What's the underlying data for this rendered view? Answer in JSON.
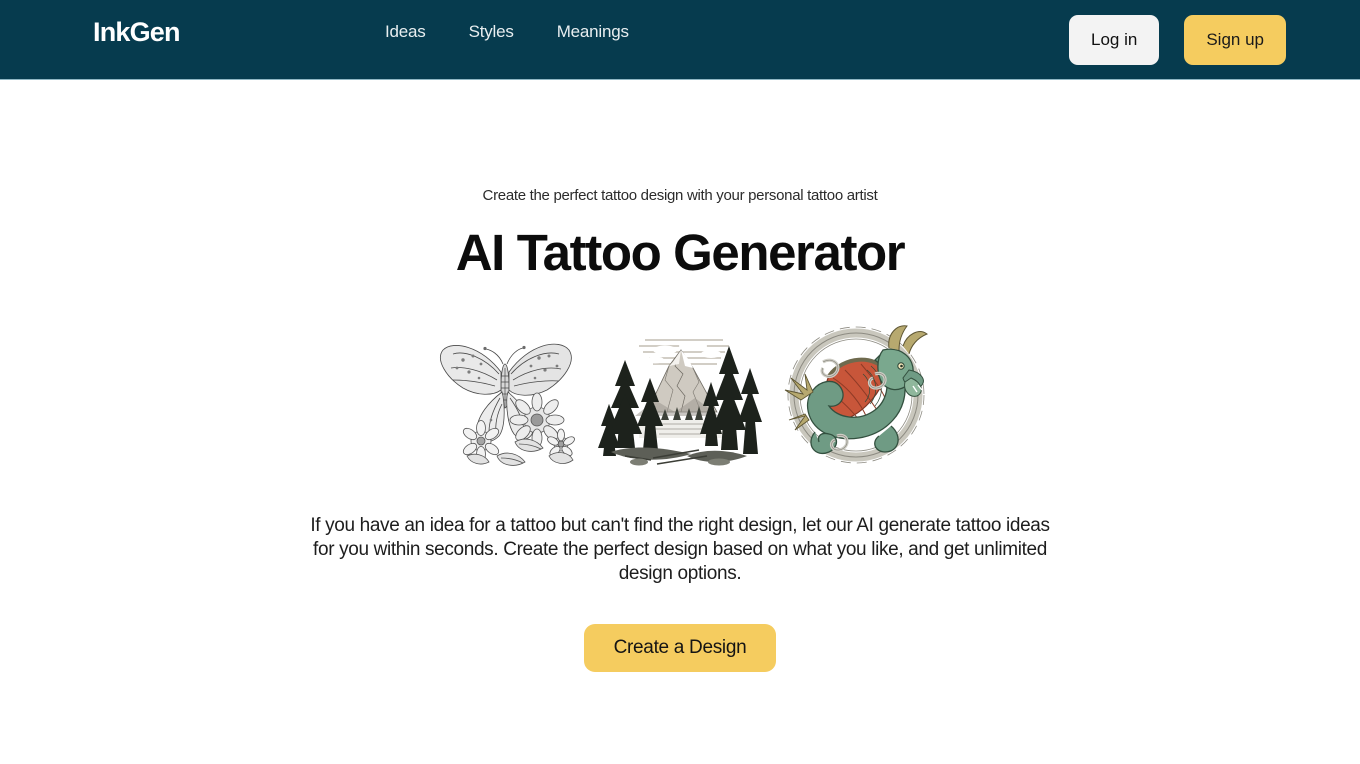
{
  "header": {
    "logo_text": "InkGen",
    "nav": [
      {
        "label": "Ideas"
      },
      {
        "label": "Styles"
      },
      {
        "label": "Meanings"
      }
    ],
    "login_label": "Log in",
    "signup_label": "Sign up",
    "background_color": "#063b4e"
  },
  "hero": {
    "tagline": "Create the perfect tattoo design with your personal tattoo artist",
    "title": "AI Tattoo Generator",
    "description": "If you have an idea for a tattoo but can't find the right design, let our AI generate tattoo ideas for you within seconds. Create the perfect design based on what you like, and get unlimited design options.",
    "cta_label": "Create a Design",
    "cta_color": "#f5cc5f"
  },
  "gallery": {
    "items": [
      {
        "name": "butterfly-flowers-tattoo",
        "alt": "Butterfly with flowers tattoo design",
        "palette": "grayscale"
      },
      {
        "name": "mountain-forest-tattoo",
        "alt": "Mountain and pine forest landscape tattoo design",
        "palette": "monochrome"
      },
      {
        "name": "dragon-circle-tattoo",
        "alt": "Green dragon with orange wings circular tattoo design",
        "palette": "color"
      }
    ]
  }
}
